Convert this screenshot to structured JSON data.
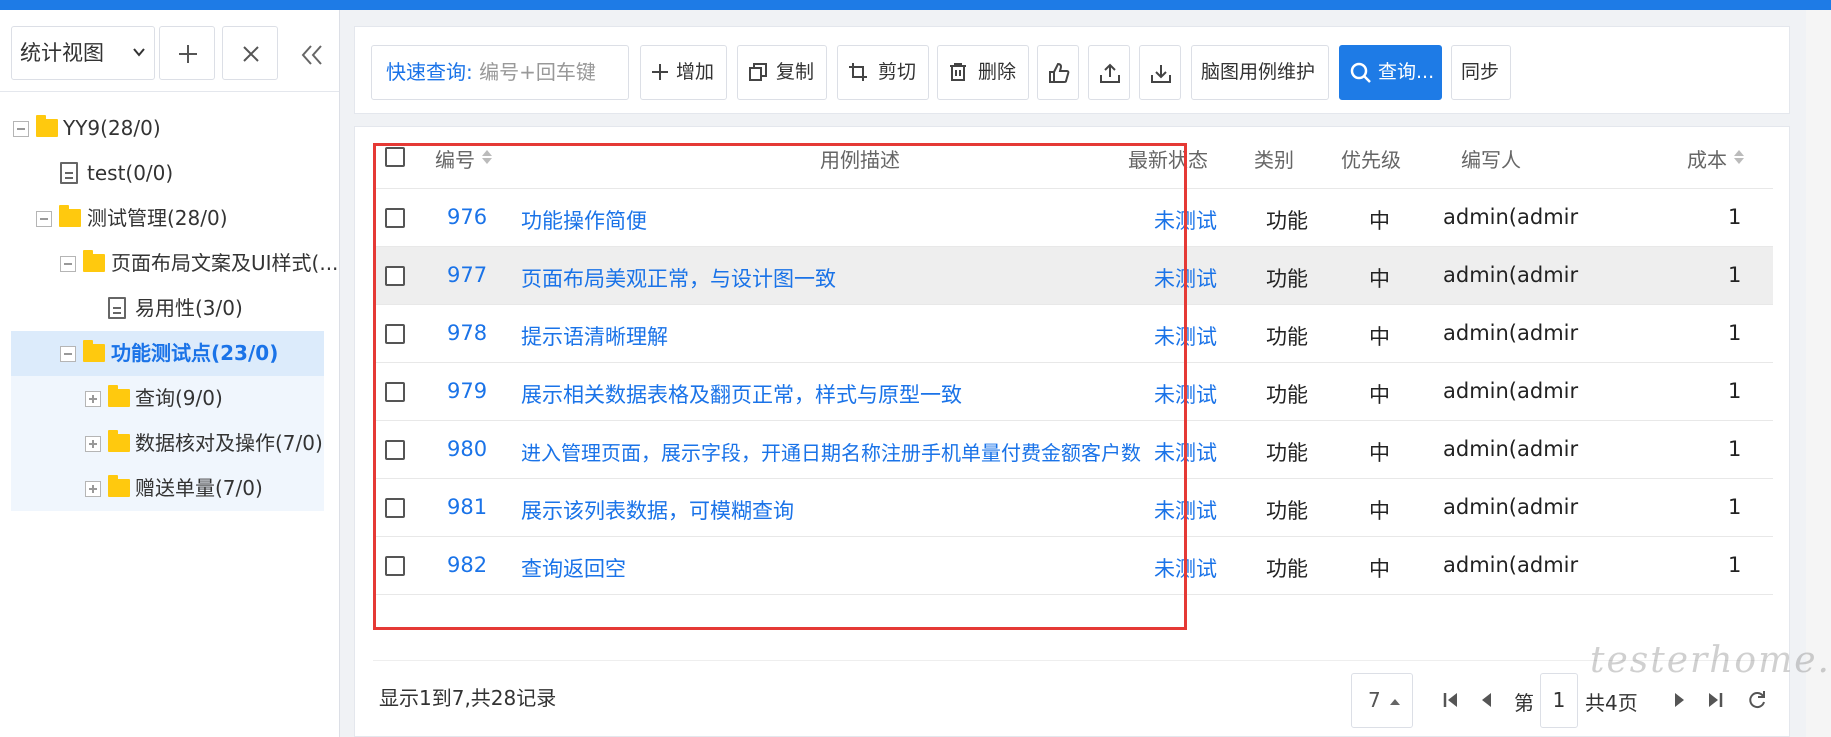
{
  "sidebar": {
    "view_select": "统计视图",
    "tree": [
      {
        "label": "YY9(28/0)"
      },
      {
        "label": "test(0/0)"
      },
      {
        "label": "测试管理(28/0)"
      },
      {
        "label": "页面布局文案及UI样式(..."
      },
      {
        "label": "易用性(3/0)"
      },
      {
        "label": "功能测试点(23/0)"
      },
      {
        "label": "查询(9/0)"
      },
      {
        "label": "数据核对及操作(7/0)"
      },
      {
        "label": "赠送单量(7/0)"
      }
    ]
  },
  "toolbar": {
    "quick_label": "快速查询:",
    "quick_placeholder": "编号+回车键",
    "add": "增加",
    "copy": "复制",
    "cut": "剪切",
    "delete": "删除",
    "mindmap": "脑图用例维护",
    "query": "查询...",
    "sync": "同步"
  },
  "table": {
    "headers": {
      "id": "编号",
      "desc": "用例描述",
      "status": "最新状态",
      "category": "类别",
      "priority": "优先级",
      "author": "编写人",
      "cost": "成本"
    },
    "rows": [
      {
        "id": "976",
        "desc": "功能操作简便",
        "status": "未测试",
        "category": "功能",
        "priority": "中",
        "author": "admin(admir",
        "cost": "1"
      },
      {
        "id": "977",
        "desc": "页面布局美观正常，与设计图一致",
        "status": "未测试",
        "category": "功能",
        "priority": "中",
        "author": "admin(admir",
        "cost": "1"
      },
      {
        "id": "978",
        "desc": "提示语清晰理解",
        "status": "未测试",
        "category": "功能",
        "priority": "中",
        "author": "admin(admir",
        "cost": "1"
      },
      {
        "id": "979",
        "desc": "展示相关数据表格及翻页正常，样式与原型一致",
        "status": "未测试",
        "category": "功能",
        "priority": "中",
        "author": "admin(admir",
        "cost": "1"
      },
      {
        "id": "980",
        "desc": "进入管理页面，展示字段，开通日期名称注册手机单量付费金额客户数",
        "status": "未测试",
        "category": "功能",
        "priority": "中",
        "author": "admin(admir",
        "cost": "1"
      },
      {
        "id": "981",
        "desc": "展示该列表数据，可模糊查询",
        "status": "未测试",
        "category": "功能",
        "priority": "中",
        "author": "admin(admir",
        "cost": "1"
      },
      {
        "id": "982",
        "desc": "查询返回空",
        "status": "未测试",
        "category": "功能",
        "priority": "中",
        "author": "admin(admir",
        "cost": "1"
      }
    ]
  },
  "footer": {
    "summary": "显示1到7,共28记录",
    "page_size": "7",
    "page_prefix": "第",
    "page_number": "1",
    "page_total": "共4页"
  },
  "watermark": "testerhome.com",
  "colors": {
    "accent": "#1e7be6",
    "link": "#1a73e8",
    "highlight": "#e53935",
    "folder": "#ffc90e"
  }
}
